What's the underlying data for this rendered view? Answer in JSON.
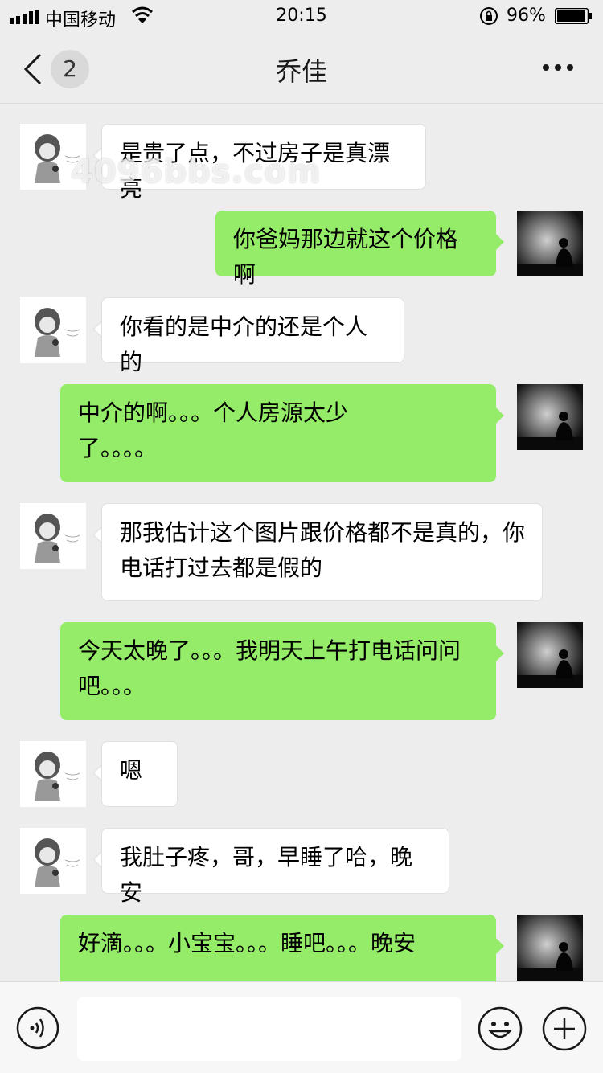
{
  "status_bar": {
    "carrier": "中国移动",
    "time": "20:15",
    "battery_percent": "96%",
    "battery_level": 0.96
  },
  "nav": {
    "unread_count": "2",
    "title": "乔佳",
    "more_label": "•••"
  },
  "watermark": "4096bbs.com",
  "messages": [
    {
      "side": "in",
      "text": "是贵了点，不过房子是真漂亮"
    },
    {
      "side": "out",
      "text": "你爸妈那边就这个价格啊"
    },
    {
      "side": "in",
      "text": "你看的是中介的还是个人的"
    },
    {
      "side": "out",
      "text": "中介的啊。。。个人房源太少了。。。。"
    },
    {
      "side": "in",
      "text": "那我估计这个图片跟价格都不是真的，你电话打过去都是假的"
    },
    {
      "side": "out",
      "text": "今天太晚了。。。我明天上午打电话问问吧。。。"
    },
    {
      "side": "in",
      "text": "嗯"
    },
    {
      "side": "in",
      "text": "我肚子疼，哥，早睡了哈，晚安"
    },
    {
      "side": "out",
      "text": "好滴。。。小宝宝。。。睡吧。。。晚安"
    }
  ],
  "input": {
    "value": "",
    "placeholder": ""
  },
  "colors": {
    "outgoing_bubble": "#95ec69",
    "incoming_bubble": "#ffffff",
    "background": "#ededed"
  },
  "icons": {
    "back": "chevron-left-icon",
    "more": "ellipsis-icon",
    "voice": "voice-icon",
    "emoji": "emoji-icon",
    "plus": "plus-icon"
  }
}
